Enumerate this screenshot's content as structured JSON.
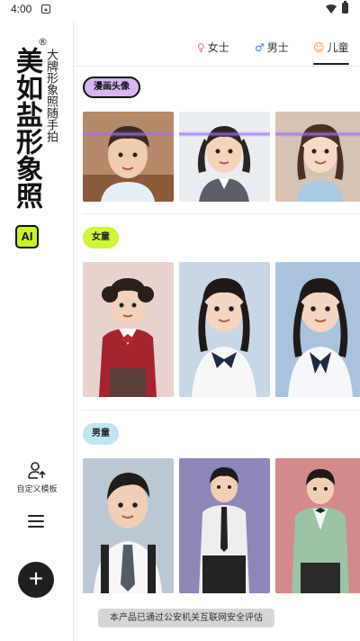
{
  "status_bar": {
    "time": "4:00",
    "icons": [
      "notification-icon",
      "wifi-icon",
      "battery-icon"
    ]
  },
  "sidebar": {
    "brand_title": "美如盐形象照",
    "brand_registered": "®",
    "brand_slogan": "大牌形象照随手拍",
    "ai_badge": "AI",
    "custom_template_label": "自定义模板",
    "accent_color": "#c8f524"
  },
  "tabs": [
    {
      "label": "女士",
      "icon": "female-icon",
      "color": "#e86aa8"
    },
    {
      "label": "男士",
      "icon": "male-icon",
      "color": "#3d7fe0"
    },
    {
      "label": "儿童",
      "icon": "child-icon",
      "color": "#f08a3c",
      "active": true
    }
  ],
  "sections": [
    {
      "label": "漫画头像",
      "color": "#d8b6f0",
      "photos": [
        "boy-portrait",
        "girl-pigtails-uniform",
        "girl-blue-dress"
      ]
    },
    {
      "label": "女童",
      "color": "#cff53a",
      "photos": [
        "girl-red-cardigan",
        "girl-white-shirt-bow",
        "girl-blue-bow"
      ]
    },
    {
      "label": "男童",
      "color": "#bfe6f0",
      "photos": [
        "boy-tie-suspenders",
        "boy-purple-backdrop",
        "boy-green-suit"
      ]
    }
  ],
  "toast": "本产品已通过公安机关互联网安全评估"
}
